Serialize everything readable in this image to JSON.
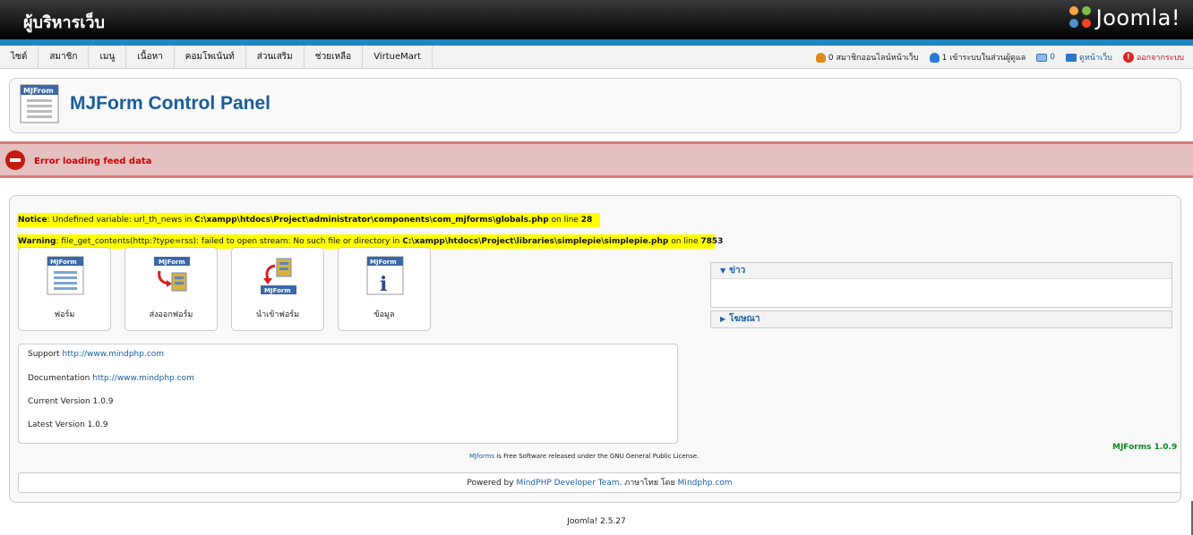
{
  "header": {
    "title": "ผู้บริหารเว็บ",
    "logo_text": "Joomla!"
  },
  "menu": [
    "ไซต์",
    "สมาชิก",
    "เมนู",
    "เนื้อหา",
    "คอมโพเน้นท์",
    "ส่วนเสริม",
    "ช่วยเหลือ",
    "VirtueMart"
  ],
  "status": {
    "online_visitors": "0 สมาชิกออนไลน์หน้าเว็บ",
    "admin_logged": "1 เข้าระบบในส่วนผู้ดูแล",
    "messages": "0",
    "view_site": "ดูหน้าเว็บ",
    "logout": "ออกจากระบบ"
  },
  "toolbar": {
    "icon_label": "MJFrom",
    "title": "MJForm Control Panel"
  },
  "error": {
    "message": "Error loading feed data"
  },
  "notices": {
    "notice_label": "Notice",
    "notice_text": ": Undefined variable: url_th_news in ",
    "notice_path": "C:\\xampp\\htdocs\\Project\\administrator\\components\\com_mjforms\\globals.php",
    "notice_line_pre": " on line ",
    "notice_line": "28",
    "warning_label": "Warning",
    "warning_text": ": file_get_contents(http:?type=rss): failed to open stream: No such file or directory in ",
    "warning_path": "C:\\xampp\\htdocs\\Project\\libraries\\simplepie\\simplepie.php",
    "warning_line_pre": " on line ",
    "warning_line": "7853"
  },
  "cpanel": [
    {
      "label": "ฟอร์ม",
      "icon": "form-icon"
    },
    {
      "label": "ส่งออกฟอร์ม",
      "icon": "export-form-icon"
    },
    {
      "label": "นำเข้าฟอร์ม",
      "icon": "import-form-icon"
    },
    {
      "label": "ข้อมูล",
      "icon": "info-icon"
    }
  ],
  "icon_badge": "MJForm",
  "info": {
    "support_label": "Support ",
    "support_link": "http://www.mindphp.com",
    "doc_label": "Documentation ",
    "doc_link": "http://www.mindphp.com",
    "current_version": "Current Version 1.0.9",
    "latest_version": "Latest Version 1.0.9"
  },
  "panels": {
    "news": "ข่าว",
    "ads": "โฆษณา"
  },
  "mjforms_version": "MJForms 1.0.9",
  "license": {
    "link": "MJforms",
    "text": " is Free Software released under the GNU General Public License."
  },
  "powered": {
    "pre": "Powered by ",
    "team": "MindPHP Developer Team",
    "mid": ". ภาษาไทย โดย ",
    "site": "Mindphp.com"
  },
  "footer": "Joomla! 2.5.27",
  "colors": {
    "accent_blue": "#1f86c4",
    "title_blue": "#1a5c9c",
    "error_red": "#c00",
    "highlight": "#ffff00",
    "version_green": "#0a8a1a"
  }
}
